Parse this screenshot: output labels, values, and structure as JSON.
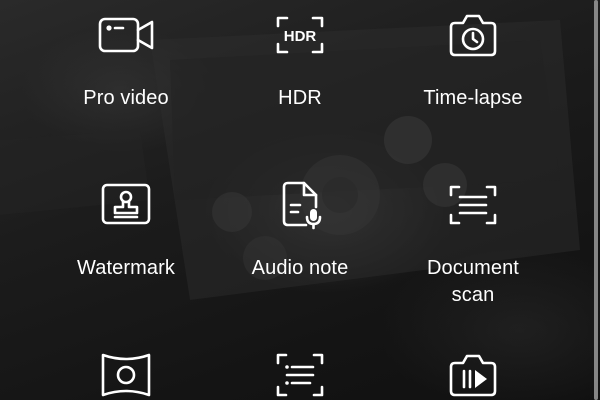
{
  "features": [
    {
      "id": "pro-video",
      "label": "Pro video",
      "icon": "video-camera-icon"
    },
    {
      "id": "hdr",
      "label": "HDR",
      "icon": "hdr-icon",
      "icon_text": "HDR"
    },
    {
      "id": "time-lapse",
      "label": "Time-lapse",
      "icon": "timelapse-camera-icon"
    },
    {
      "id": "watermark",
      "label": "Watermark",
      "icon": "stamp-icon"
    },
    {
      "id": "audio-note",
      "label": "Audio note",
      "icon": "audio-note-icon"
    },
    {
      "id": "document-scan",
      "label": "Document\nscan",
      "label_line1": "Document",
      "label_line2": "scan",
      "icon": "document-scan-icon"
    },
    {
      "id": "panorama",
      "label": "",
      "icon": "panorama-icon"
    },
    {
      "id": "super-macro",
      "label": "",
      "icon": "scan-lines-icon"
    },
    {
      "id": "slow-motion",
      "label": "",
      "icon": "camera-play-icon"
    }
  ],
  "colors": {
    "foreground": "#ffffff",
    "background": "#1a1a1a",
    "scrollbar": "#9a9a9a"
  }
}
